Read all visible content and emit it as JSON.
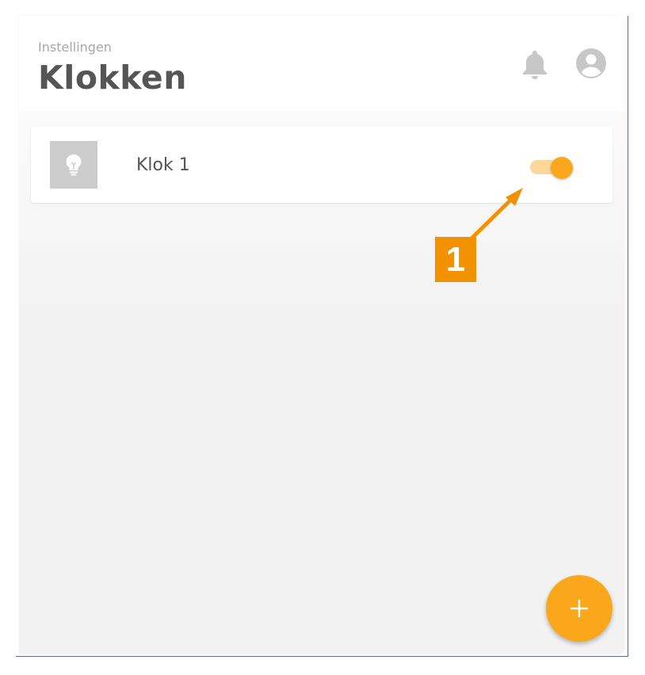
{
  "header": {
    "subtitle": "Instellingen",
    "title": "Klokken",
    "icons": [
      "bell-icon",
      "account-icon"
    ]
  },
  "clocks": [
    {
      "name": "Klok 1",
      "icon": "lightbulb-icon",
      "enabled": true
    }
  ],
  "fab": {
    "icon": "plus-icon"
  },
  "callout": {
    "label": "1"
  },
  "colors": {
    "accent": "#fba71b",
    "accent_light": "#fcd79a",
    "callout": "#f39200",
    "title": "#555555",
    "subtitle": "#a7a7a7",
    "thumbnail": "#cccccc",
    "background": "#f2f2f3"
  }
}
